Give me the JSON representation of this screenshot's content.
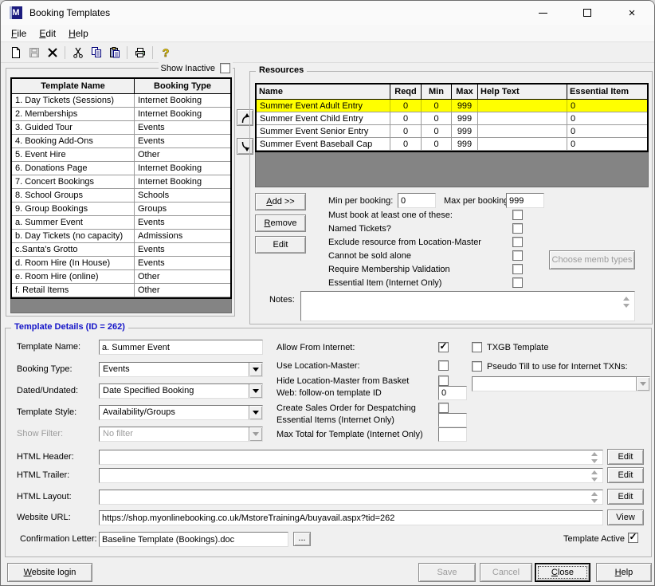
{
  "colors": {
    "highlight": "#ffff00",
    "filler": "#848484",
    "group_title": "#1414c8"
  },
  "window": {
    "title": "Booking Templates",
    "icon_letter": "M"
  },
  "menu": {
    "items": [
      {
        "label": "File"
      },
      {
        "label": "Edit"
      },
      {
        "label": "Help"
      }
    ]
  },
  "toolbar": {
    "buttons": [
      {
        "icon": "new-document-icon"
      },
      {
        "icon": "save-icon",
        "disabled": true
      },
      {
        "icon": "delete-icon"
      },
      {
        "icon": "cut-icon"
      },
      {
        "icon": "copy-icon"
      },
      {
        "icon": "paste-icon"
      },
      {
        "icon": "print-icon"
      },
      {
        "icon": "help-icon"
      }
    ]
  },
  "template_list": {
    "show_inactive_label": "Show Inactive",
    "show_inactive_checked": false,
    "columns": [
      "Template Name",
      "Booking Type"
    ],
    "rows": [
      [
        "1. Day Tickets (Sessions)",
        "Internet Booking"
      ],
      [
        "2. Memberships",
        "Internet Booking"
      ],
      [
        "3. Guided Tour",
        "Events"
      ],
      [
        "4. Booking Add-Ons",
        "Events"
      ],
      [
        "5. Event Hire",
        "Other"
      ],
      [
        "6. Donations Page",
        "Internet Booking"
      ],
      [
        "7. Concert Bookings",
        "Internet Booking"
      ],
      [
        "8. School Groups",
        "Schools"
      ],
      [
        "9. Group Bookings",
        "Groups"
      ],
      [
        "a. Summer Event",
        "Events"
      ],
      [
        "b. Day Tickets (no capacity)",
        "Admissions"
      ],
      [
        "c.Santa's Grotto",
        "Events"
      ],
      [
        "d. Room Hire (In House)",
        "Events"
      ],
      [
        "e. Room Hire (online)",
        "Other"
      ],
      [
        "f. Retail Items",
        "Other"
      ]
    ]
  },
  "resources": {
    "group_label": "Resources",
    "columns": [
      "Name",
      "Reqd",
      "Min",
      "Max",
      "Help Text",
      "Essential Item"
    ],
    "selected_row": 0,
    "rows": [
      [
        "Summer Event Adult Entry",
        "0",
        "0",
        "999",
        "",
        "0"
      ],
      [
        "Summer Event Child Entry",
        "0",
        "0",
        "999",
        "",
        "0"
      ],
      [
        "Summer Event Senior Entry",
        "0",
        "0",
        "999",
        "",
        "0"
      ],
      [
        "Summer Event Baseball Cap",
        "0",
        "0",
        "999",
        "",
        "0"
      ]
    ],
    "add_button": "Add >>",
    "remove_button": "Remove",
    "edit_button": "Edit",
    "min_per_booking": {
      "label": "Min per booking:",
      "value": "0"
    },
    "max_per_booking": {
      "label": "Max per booking:",
      "value": "999"
    },
    "options": [
      {
        "label": "Must book at least one of these:",
        "checked": false
      },
      {
        "label": "Named Tickets?",
        "checked": false
      },
      {
        "label": "Exclude resource from Location-Master",
        "checked": false
      },
      {
        "label": "Cannot be sold alone",
        "checked": false
      },
      {
        "label": "Require Membership Validation",
        "checked": false
      },
      {
        "label": "Essential Item (Internet Only)",
        "checked": false
      }
    ],
    "choose_memb_button": "Choose memb types",
    "notes": {
      "label": "Notes:",
      "value": ""
    }
  },
  "template_details": {
    "group_label": "Template Details (ID = 262)",
    "template_name": {
      "label": "Template Name:",
      "value": "a. Summer Event"
    },
    "booking_type": {
      "label": "Booking Type:",
      "value": "Events"
    },
    "dated_undated": {
      "label": "Dated/Undated:",
      "value": "Date Specified Booking"
    },
    "template_style": {
      "label": "Template Style:",
      "value": "Availability/Groups"
    },
    "show_filter": {
      "label": "Show Filter:",
      "value": "No filter"
    },
    "allow_from_internet": {
      "label": "Allow From Internet:",
      "checked": true
    },
    "use_location_master": {
      "label": "Use Location-Master:",
      "checked": false
    },
    "hide_location_master": {
      "label": "Hide Location-Master from Basket",
      "checked": false
    },
    "web_follow_on": {
      "label": "Web: follow-on template ID",
      "value": "0"
    },
    "create_sales_order": {
      "label": "Create Sales Order for Despatching",
      "checked": false
    },
    "essential_items": {
      "label": "Essential Items (Internet Only)",
      "value": ""
    },
    "max_total": {
      "label": "Max Total for Template (Internet Only)",
      "value": ""
    },
    "txgb": {
      "label": "TXGB Template",
      "checked": false
    },
    "pseudo_till": {
      "label": "Pseudo Till to use for Internet TXNs:",
      "checked": false,
      "value": ""
    },
    "html_header": {
      "label": "HTML Header:",
      "value": "",
      "button": "Edit"
    },
    "html_trailer": {
      "label": "HTML Trailer:",
      "value": "",
      "button": "Edit"
    },
    "html_layout": {
      "label": "HTML Layout:",
      "value": "",
      "button": "Edit"
    },
    "website_url": {
      "label": "Website URL:",
      "value": "https://shop.myonlinebooking.co.uk/MstoreTrainingA/buyavail.aspx?tid=262",
      "button": "View"
    },
    "confirmation_letter": {
      "label": "Confirmation Letter:",
      "value": "Baseline Template (Bookings).doc",
      "browse_button": "..."
    },
    "template_active": {
      "label": "Template Active",
      "checked": true
    }
  },
  "footer": {
    "website_login": "Website login",
    "save": "Save",
    "cancel": "Cancel",
    "close": "Close",
    "help": "Help"
  }
}
